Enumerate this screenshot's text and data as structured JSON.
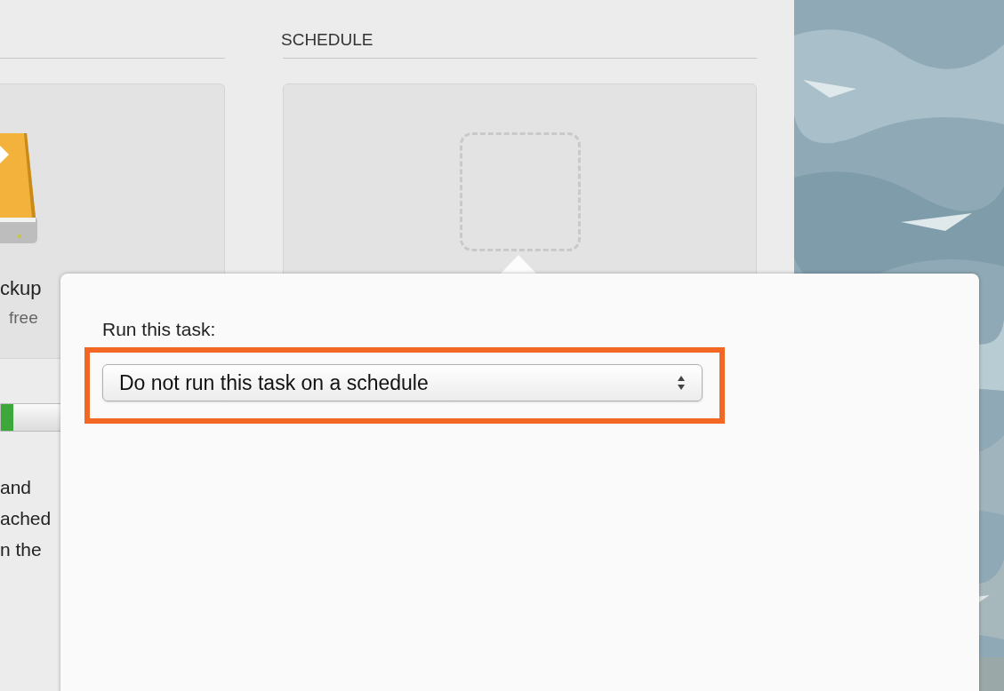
{
  "left_panel": {
    "drive_name": "ckup",
    "drive_free": "free",
    "description": [
      "and",
      "ached",
      "n the"
    ]
  },
  "schedule_panel": {
    "title": "SCHEDULE"
  },
  "popover": {
    "label": "Run this task:",
    "select": {
      "value": "Do not run this task on a schedule"
    },
    "highlighted": true
  }
}
